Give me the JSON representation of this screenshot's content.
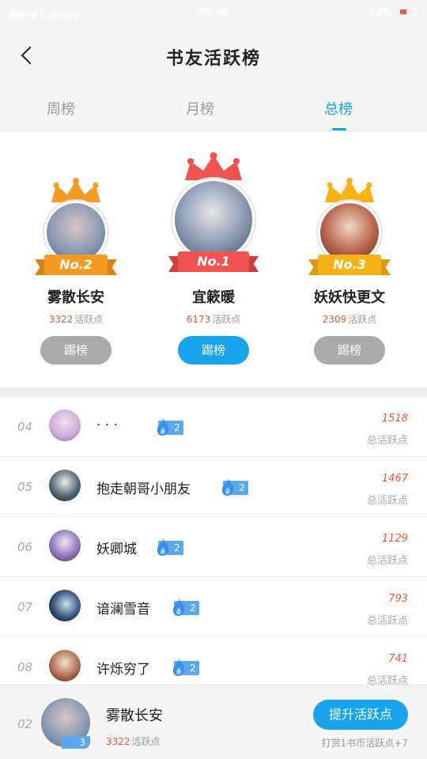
{
  "status_bar": {
    "carrier": "无SIM 0.96K/s",
    "time": "00:46",
    "battery": "12%"
  },
  "header": {
    "title": "书友活跃榜"
  },
  "tabs": [
    {
      "label": "周榜",
      "active": false
    },
    {
      "label": "月榜",
      "active": false
    },
    {
      "label": "总榜",
      "active": true
    }
  ],
  "podium": [
    {
      "rank_label": "No.2",
      "name": "雾散长安",
      "points": "3322",
      "points_unit": "活跃点",
      "button": "踢榜",
      "color": "#f59b23"
    },
    {
      "rank_label": "No.1",
      "name": "宜簌暖",
      "points": "6173",
      "points_unit": "活跃点",
      "button": "踢榜",
      "color": "#f0524f"
    },
    {
      "rank_label": "No.3",
      "name": "妖妖快更文",
      "points": "2309",
      "points_unit": "活跃点",
      "button": "踢榜",
      "color": "#f7b316"
    }
  ],
  "list": [
    {
      "rank": "04",
      "name": "· · ·",
      "level": "2",
      "score": "1518",
      "score_label": "总活跃点",
      "avatar_color": "#c9a9d6"
    },
    {
      "rank": "05",
      "name": "抱走朝哥小朋友",
      "level": "2",
      "score": "1467",
      "score_label": "总活跃点",
      "avatar_color": "#4a5e6a"
    },
    {
      "rank": "06",
      "name": "妖卿城",
      "level": "2",
      "score": "1129",
      "score_label": "总活跃点",
      "avatar_color": "#8a6fb6"
    },
    {
      "rank": "07",
      "name": "谙澜雪音",
      "level": "2",
      "score": "793",
      "score_label": "总活跃点",
      "avatar_color": "#2b4670"
    },
    {
      "rank": "08",
      "name": "许烁穷了",
      "level": "2",
      "score": "741",
      "score_label": "总活跃点",
      "avatar_color": "#a8664a"
    }
  ],
  "me": {
    "rank": "02",
    "name": "雾散长安",
    "level": "3",
    "points": "3322",
    "points_unit": "活跃点",
    "button": "提升活跃点",
    "hint": "打赏1书币活跃点+7"
  },
  "colors": {
    "accent": "#17a4ea",
    "score": "#e65a3b",
    "badge": "#5ba8ef"
  }
}
